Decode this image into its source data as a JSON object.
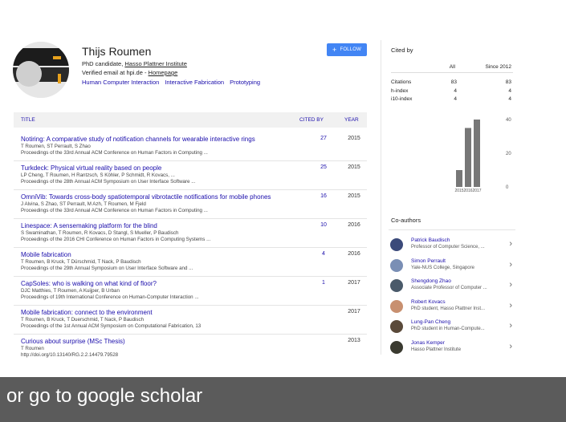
{
  "profile": {
    "name": "Thijs Roumen",
    "role_prefix": "PhD candidate, ",
    "affiliation": "Hasso Plattner Institute",
    "email_prefix": "Verified email at hpi.de - ",
    "homepage": "Homepage",
    "interests": [
      "Human Computer Interaction",
      "Interactive Fabrication",
      "Prototyping"
    ],
    "follow_label": "FOLLOW"
  },
  "table": {
    "col_title": "TITLE",
    "col_cited": "CITED BY",
    "col_year": "YEAR",
    "rows": [
      {
        "title": "Notiring: A comparative study of notification channels for wearable interactive rings",
        "authors": "T Roumen, ST Perrault, S Zhao",
        "venue": "Proceedings of the 33rd Annual ACM Conference on Human Factors in Computing ...",
        "cited": "27",
        "year": "2015"
      },
      {
        "title": "Turkdeck: Physical virtual reality based on people",
        "authors": "LP Cheng, T Roumen, H Rantzsch, S Köhler, P Schmidt, R Kovacs, ...",
        "venue": "Proceedings of the 28th Annual ACM Symposium on User Interface Software ...",
        "cited": "25",
        "year": "2015"
      },
      {
        "title": "OmniVib: Towards cross-body spatiotemporal vibrotactile notifications for mobile phones",
        "authors": "J Alvina, S Zhao, ST Perrault, M Azh, T Roumen, M Fjeld",
        "venue": "Proceedings of the 33rd Annual ACM Conference on Human Factors in Computing ...",
        "cited": "16",
        "year": "2015"
      },
      {
        "title": "Linespace: A sensemaking platform for the blind",
        "authors": "S Swaminathan, T Roumen, R Kovacs, D Stangl, S Mueller, P Baudisch",
        "venue": "Proceedings of the 2016 CHI Conference on Human Factors in Computing Systems ...",
        "cited": "10",
        "year": "2016"
      },
      {
        "title": "Mobile fabrication",
        "authors": "T Roumen, B Kruck, T Dürschmid, T Nack, P Baudisch",
        "venue": "Proceedings of the 29th Annual Symposium on User Interface Software and ...",
        "cited": "4",
        "year": "2016"
      },
      {
        "title": "CapSoles: who is walking on what kind of floor?",
        "authors": "DJC Matthies, T Roumen, A Kuijper, B Urban",
        "venue": "Proceedings of 19th International Conference on Human-Computer Interaction ...",
        "cited": "1",
        "year": "2017"
      },
      {
        "title": "Mobile fabrication: connect to the environment",
        "authors": "T Roumen, B Kruck, T Duerschmid, T Nack, P Baudisch",
        "venue": "Proceedings of the 1st Annual ACM Symposium on Computational Fabrication, 13",
        "cited": "",
        "year": "2017"
      },
      {
        "title": "Curious about surprise (MSc Thesis)",
        "authors": "T Roumen",
        "venue": "http://doi.org/10.13140/RG.2.2.14479.79528",
        "cited": "",
        "year": "2013"
      }
    ]
  },
  "cited_by": {
    "title": "Cited by",
    "col_all": "All",
    "col_since": "Since 2012",
    "rows": [
      {
        "label": "Citations",
        "all": "83",
        "since": "83"
      },
      {
        "label": "h-index",
        "all": "4",
        "since": "4"
      },
      {
        "label": "i10-index",
        "all": "4",
        "since": "4"
      }
    ]
  },
  "chart_data": {
    "type": "bar",
    "categories": [
      "2015",
      "2016",
      "2017"
    ],
    "values": [
      10,
      35,
      40
    ],
    "ylim": [
      0,
      40
    ],
    "yticks": [
      "0",
      "20",
      "40"
    ],
    "bar_color": "#777777"
  },
  "coauthors": {
    "title": "Co-authors",
    "items": [
      {
        "name": "Patrick Baudisch",
        "detail": "Professor of Computer Science, ...",
        "color": "#3b4a7a"
      },
      {
        "name": "Simon Perrault",
        "detail": "Yale-NUS College, Singapore",
        "color": "#7a8fb5"
      },
      {
        "name": "Shengdong Zhao",
        "detail": "Associate Professor of Computer ...",
        "color": "#4a5a6a"
      },
      {
        "name": "Robert Kovacs",
        "detail": "PhD student, Hasso Plattner Inst...",
        "color": "#c89070"
      },
      {
        "name": "Lung-Pan Cheng",
        "detail": "PhD student in Human-Compute...",
        "color": "#5a4a3a"
      },
      {
        "name": "Jonas Kemper",
        "detail": "Hasso Plattner Institute",
        "color": "#3a3a30"
      }
    ]
  },
  "footer": {
    "text": "or go to google scholar"
  }
}
